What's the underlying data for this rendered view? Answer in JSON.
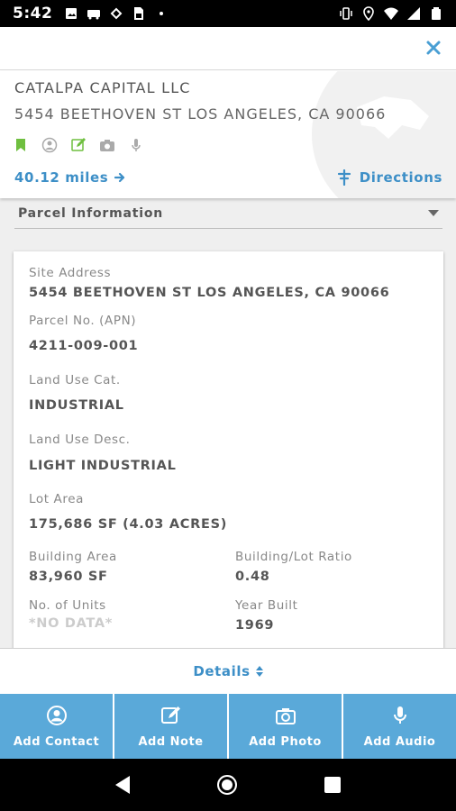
{
  "status_bar": {
    "time": "5:42",
    "left_icons": [
      "image-icon",
      "car-icon",
      "sync-icon",
      "sim-icon",
      "dot-icon"
    ],
    "right_icons": [
      "vibrate-icon",
      "location-icon",
      "wifi-icon",
      "signal-icon",
      "battery-icon"
    ]
  },
  "header": {
    "close_icon": "close-icon"
  },
  "property": {
    "owner": "CATALPA CAPITAL LLC",
    "address": "5454 BEETHOVEN ST LOS ANGELES, CA 90066",
    "icons": [
      "bookmark-icon",
      "contact-icon",
      "note-icon",
      "camera-icon",
      "mic-icon"
    ],
    "distance": "40.12 miles",
    "directions": "Directions",
    "accent_color": "#3d8fc7",
    "bookmark_color": "#6fbf3f"
  },
  "section": {
    "title": "Parcel Information"
  },
  "parcel": {
    "site_address_label": "Site Address",
    "site_address": "5454 BEETHOVEN ST LOS ANGELES, CA 90066",
    "apn_label": "Parcel No. (APN)",
    "apn": "4211-009-001",
    "land_use_cat_label": "Land Use Cat.",
    "land_use_cat": "INDUSTRIAL",
    "land_use_desc_label": "Land Use Desc.",
    "land_use_desc": "LIGHT INDUSTRIAL",
    "lot_area_label": "Lot Area",
    "lot_area": "175,686 SF (4.03 ACRES)",
    "building_area_label": "Building Area",
    "building_area": "83,960 SF",
    "ratio_label": "Building/Lot Ratio",
    "ratio": "0.48",
    "units_label": "No. of Units",
    "units": "*NO DATA*",
    "year_built_label": "Year Built",
    "year_built": "1969"
  },
  "details": {
    "label": "Details"
  },
  "bottom_actions": [
    {
      "label": "Add Contact",
      "icon": "contact-icon"
    },
    {
      "label": "Add Note",
      "icon": "note-icon"
    },
    {
      "label": "Add Photo",
      "icon": "camera-icon"
    },
    {
      "label": "Add Audio",
      "icon": "mic-icon"
    }
  ],
  "colors": {
    "button_bg": "#5aa9d9"
  }
}
